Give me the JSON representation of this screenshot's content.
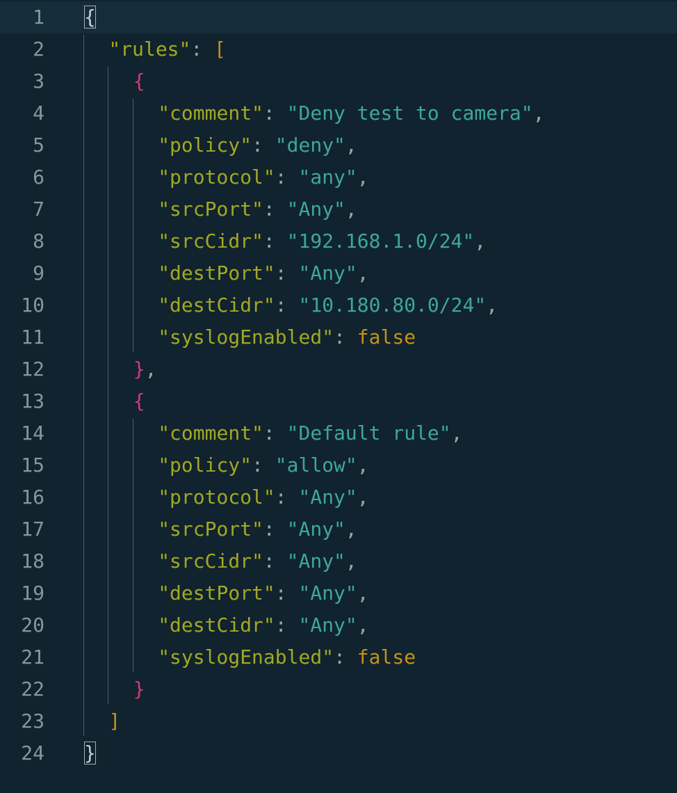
{
  "editor": {
    "language": "JSON",
    "current_line": 1,
    "colors": {
      "background": "#10232e",
      "current_line": "#152d3a",
      "key": "#a3a822",
      "string": "#3fa79a",
      "literal": "#c8901c",
      "brace_pink": "#d3397e",
      "line_number": "#8a969c"
    },
    "lines": [
      {
        "n": "1",
        "indent": 0,
        "tokens": [
          {
            "t": "{",
            "c": "bracket-match"
          }
        ]
      },
      {
        "n": "2",
        "indent": 1,
        "tokens": [
          {
            "t": "\"rules\"",
            "c": "key"
          },
          {
            "t": ": ",
            "c": "punc"
          },
          {
            "t": "[",
            "c": "bracket-gold"
          }
        ]
      },
      {
        "n": "3",
        "indent": 2,
        "tokens": [
          {
            "t": "{",
            "c": "bracket-pink"
          }
        ]
      },
      {
        "n": "4",
        "indent": 3,
        "tokens": [
          {
            "t": "\"comment\"",
            "c": "key"
          },
          {
            "t": ": ",
            "c": "punc"
          },
          {
            "t": "\"Deny test to camera\"",
            "c": "str"
          },
          {
            "t": ",",
            "c": "punc"
          }
        ]
      },
      {
        "n": "5",
        "indent": 3,
        "tokens": [
          {
            "t": "\"policy\"",
            "c": "key"
          },
          {
            "t": ": ",
            "c": "punc"
          },
          {
            "t": "\"deny\"",
            "c": "str"
          },
          {
            "t": ",",
            "c": "punc"
          }
        ]
      },
      {
        "n": "6",
        "indent": 3,
        "tokens": [
          {
            "t": "\"protocol\"",
            "c": "key"
          },
          {
            "t": ": ",
            "c": "punc"
          },
          {
            "t": "\"any\"",
            "c": "str"
          },
          {
            "t": ",",
            "c": "punc"
          }
        ]
      },
      {
        "n": "7",
        "indent": 3,
        "tokens": [
          {
            "t": "\"srcPort\"",
            "c": "key"
          },
          {
            "t": ": ",
            "c": "punc"
          },
          {
            "t": "\"Any\"",
            "c": "str"
          },
          {
            "t": ",",
            "c": "punc"
          }
        ]
      },
      {
        "n": "8",
        "indent": 3,
        "tokens": [
          {
            "t": "\"srcCidr\"",
            "c": "key"
          },
          {
            "t": ": ",
            "c": "punc"
          },
          {
            "t": "\"192.168.1.0/24\"",
            "c": "str"
          },
          {
            "t": ",",
            "c": "punc"
          }
        ]
      },
      {
        "n": "9",
        "indent": 3,
        "tokens": [
          {
            "t": "\"destPort\"",
            "c": "key"
          },
          {
            "t": ": ",
            "c": "punc"
          },
          {
            "t": "\"Any\"",
            "c": "str"
          },
          {
            "t": ",",
            "c": "punc"
          }
        ]
      },
      {
        "n": "10",
        "indent": 3,
        "tokens": [
          {
            "t": "\"destCidr\"",
            "c": "key"
          },
          {
            "t": ": ",
            "c": "punc"
          },
          {
            "t": "\"10.180.80.0/24\"",
            "c": "str"
          },
          {
            "t": ",",
            "c": "punc"
          }
        ]
      },
      {
        "n": "11",
        "indent": 3,
        "tokens": [
          {
            "t": "\"syslogEnabled\"",
            "c": "key"
          },
          {
            "t": ": ",
            "c": "punc"
          },
          {
            "t": "false",
            "c": "lit"
          }
        ]
      },
      {
        "n": "12",
        "indent": 2,
        "tokens": [
          {
            "t": "}",
            "c": "bracket-pink"
          },
          {
            "t": ",",
            "c": "punc"
          }
        ]
      },
      {
        "n": "13",
        "indent": 2,
        "tokens": [
          {
            "t": "{",
            "c": "bracket-pink"
          }
        ]
      },
      {
        "n": "14",
        "indent": 3,
        "tokens": [
          {
            "t": "\"comment\"",
            "c": "key"
          },
          {
            "t": ": ",
            "c": "punc"
          },
          {
            "t": "\"Default rule\"",
            "c": "str"
          },
          {
            "t": ",",
            "c": "punc"
          }
        ]
      },
      {
        "n": "15",
        "indent": 3,
        "tokens": [
          {
            "t": "\"policy\"",
            "c": "key"
          },
          {
            "t": ": ",
            "c": "punc"
          },
          {
            "t": "\"allow\"",
            "c": "str"
          },
          {
            "t": ",",
            "c": "punc"
          }
        ]
      },
      {
        "n": "16",
        "indent": 3,
        "tokens": [
          {
            "t": "\"protocol\"",
            "c": "key"
          },
          {
            "t": ": ",
            "c": "punc"
          },
          {
            "t": "\"Any\"",
            "c": "str"
          },
          {
            "t": ",",
            "c": "punc"
          }
        ]
      },
      {
        "n": "17",
        "indent": 3,
        "tokens": [
          {
            "t": "\"srcPort\"",
            "c": "key"
          },
          {
            "t": ": ",
            "c": "punc"
          },
          {
            "t": "\"Any\"",
            "c": "str"
          },
          {
            "t": ",",
            "c": "punc"
          }
        ]
      },
      {
        "n": "18",
        "indent": 3,
        "tokens": [
          {
            "t": "\"srcCidr\"",
            "c": "key"
          },
          {
            "t": ": ",
            "c": "punc"
          },
          {
            "t": "\"Any\"",
            "c": "str"
          },
          {
            "t": ",",
            "c": "punc"
          }
        ]
      },
      {
        "n": "19",
        "indent": 3,
        "tokens": [
          {
            "t": "\"destPort\"",
            "c": "key"
          },
          {
            "t": ": ",
            "c": "punc"
          },
          {
            "t": "\"Any\"",
            "c": "str"
          },
          {
            "t": ",",
            "c": "punc"
          }
        ]
      },
      {
        "n": "20",
        "indent": 3,
        "tokens": [
          {
            "t": "\"destCidr\"",
            "c": "key"
          },
          {
            "t": ": ",
            "c": "punc"
          },
          {
            "t": "\"Any\"",
            "c": "str"
          },
          {
            "t": ",",
            "c": "punc"
          }
        ]
      },
      {
        "n": "21",
        "indent": 3,
        "tokens": [
          {
            "t": "\"syslogEnabled\"",
            "c": "key"
          },
          {
            "t": ": ",
            "c": "punc"
          },
          {
            "t": "false",
            "c": "lit"
          }
        ]
      },
      {
        "n": "22",
        "indent": 2,
        "tokens": [
          {
            "t": "}",
            "c": "bracket-pink"
          }
        ]
      },
      {
        "n": "23",
        "indent": 1,
        "tokens": [
          {
            "t": "]",
            "c": "bracket-gold"
          }
        ]
      },
      {
        "n": "24",
        "indent": 0,
        "tokens": [
          {
            "t": "}",
            "c": "bracket-match"
          }
        ]
      }
    ]
  }
}
